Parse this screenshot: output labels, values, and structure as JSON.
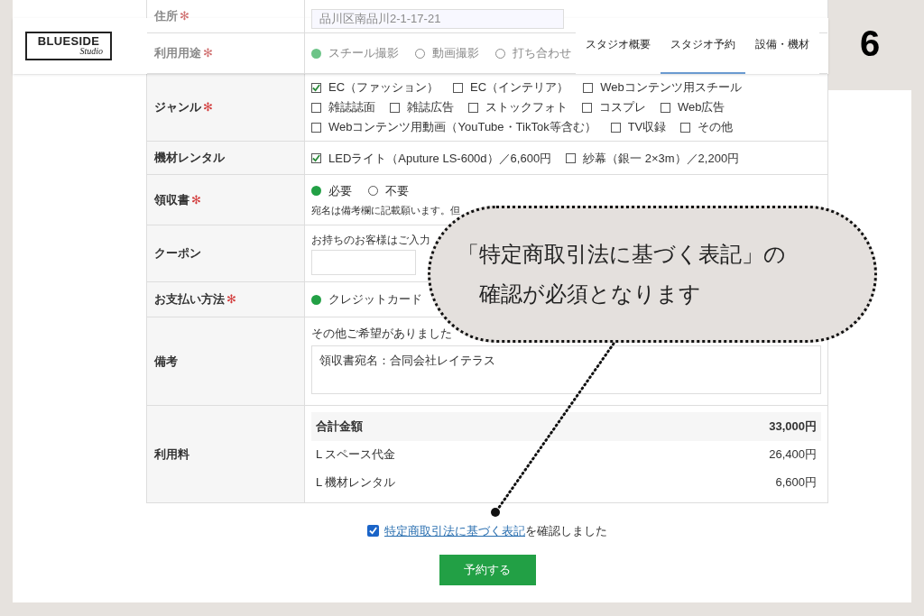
{
  "step_number": "6",
  "header": {
    "logo": {
      "line1": "BLUESIDE",
      "line2": "Studio"
    },
    "nav": [
      {
        "label": "スタジオ概要",
        "selected": false
      },
      {
        "label": "スタジオ予約",
        "selected": true
      },
      {
        "label": "設備・機材",
        "selected": false
      }
    ]
  },
  "form": {
    "rows_under_header": [
      {
        "label": "住所",
        "required_mark": "✻",
        "kind": "text",
        "value": "品川区南品川2-1-17-21"
      },
      {
        "label": "利用用途",
        "required_mark": "✻",
        "kind": "radio",
        "options": [
          {
            "label": "スチール撮影",
            "selected": true
          },
          {
            "label": "動画撮影",
            "selected": false
          },
          {
            "label": "打ち合わせ",
            "selected": false
          }
        ]
      }
    ],
    "rows": [
      {
        "label": "ジャンル",
        "required_mark": "✻",
        "kind": "checkbox",
        "options": [
          {
            "label": "EC（ファッション）",
            "checked": true
          },
          {
            "label": "EC（インテリア）",
            "checked": false
          },
          {
            "label": "Webコンテンツ用スチール",
            "checked": false
          },
          {
            "label": "雑誌誌面",
            "checked": false
          },
          {
            "label": "雑誌広告",
            "checked": false
          },
          {
            "label": "ストックフォト",
            "checked": false
          },
          {
            "label": "コスプレ",
            "checked": false
          },
          {
            "label": "Web広告",
            "checked": false
          },
          {
            "label": "Webコンテンツ用動画（YouTube・TikTok等含む）",
            "checked": false
          },
          {
            "label": "TV収録",
            "checked": false
          },
          {
            "label": "その他",
            "checked": false
          }
        ]
      },
      {
        "label": "機材レンタル",
        "kind": "checkbox",
        "options": [
          {
            "label": "LEDライト（Aputure LS-600d）／6,600円",
            "checked": true
          },
          {
            "label": "紗幕（銀一 2×3m）／2,200円",
            "checked": false
          }
        ]
      },
      {
        "label": "領収書",
        "required_mark": "✻",
        "kind": "radio",
        "options": [
          {
            "label": "必要",
            "selected": true
          },
          {
            "label": "不要",
            "selected": false
          }
        ],
        "note": "宛名は備考欄に記載願います。但"
      },
      {
        "label": "クーポン",
        "kind": "input",
        "hint": "お持ちのお客様はご入力"
      },
      {
        "label": "お支払い方法",
        "required_mark": "✻",
        "kind": "radio",
        "options": [
          {
            "label": "クレジットカード",
            "selected": true
          }
        ]
      },
      {
        "label": "備考",
        "kind": "textarea",
        "hint": "その他ご希望がありました",
        "value": "領収書宛名：合同会社レイテラス"
      },
      {
        "label": "利用料",
        "kind": "fees",
        "total": {
          "label": "合計金額",
          "amount": "33,000円"
        },
        "items": [
          {
            "label": "L スペース代金",
            "amount": "26,400円"
          },
          {
            "label": "L 機材レンタル",
            "amount": "6,600円"
          }
        ]
      }
    ]
  },
  "consent": {
    "checked": true,
    "link": "特定商取引法に基づく表記",
    "text": "を確認しました"
  },
  "submit": {
    "label": "予約する"
  },
  "callout": {
    "lines": [
      "「特定商取引法に基づく表記」の",
      "確認が必須となります"
    ]
  }
}
